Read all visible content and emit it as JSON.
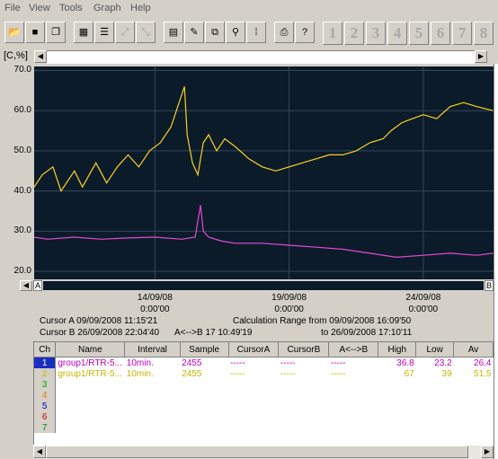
{
  "menu": [
    "File",
    "View",
    "Tools",
    "Graph",
    "Help"
  ],
  "toolbar": {
    "buttons": [
      "open-icon",
      "save-icon",
      "copy-icon",
      "channel-icon",
      "list-icon",
      "zoom-fit-icon",
      "zoom-out-icon",
      "table-icon",
      "edit-icon",
      "compare-icon",
      "link-icon",
      "cursor-icon",
      "print-icon",
      "help-icon"
    ],
    "pages": [
      {
        "label": "1",
        "active": true
      },
      {
        "label": "2",
        "active": true
      },
      {
        "label": "3",
        "active": false
      },
      {
        "label": "4",
        "active": false
      },
      {
        "label": "5",
        "active": false
      },
      {
        "label": "6",
        "active": false
      },
      {
        "label": "7",
        "active": false
      },
      {
        "label": "8",
        "active": false
      }
    ]
  },
  "unit_label": "[C,%]",
  "scrollbar": {
    "left_marker": "A",
    "right_marker": "B"
  },
  "chart_data": {
    "type": "line",
    "ylabel": "[C,%]",
    "ylim": [
      18,
      71
    ],
    "y_ticks": [
      "70.0",
      "60.0",
      "50.0",
      "40.0",
      "30.0",
      "20.0"
    ],
    "y_tick_values": [
      70,
      60,
      50,
      40,
      30,
      20
    ],
    "x_ticks": [
      {
        "date": "14/09/08",
        "time": "0:00'00",
        "x": 5
      },
      {
        "date": "19/09/08",
        "time": "0:00'00",
        "x": 10
      },
      {
        "date": "24/09/08",
        "time": "0:00'00",
        "x": 15
      }
    ],
    "xlim": [
      0.5,
      17.65
    ],
    "grid": true,
    "series": [
      {
        "name": "group1/RTR-5...",
        "color": "#f7d21e",
        "x": [
          0.5,
          0.8,
          1.2,
          1.5,
          2.0,
          2.3,
          2.8,
          3.2,
          3.6,
          4.0,
          4.4,
          4.8,
          5.2,
          5.6,
          5.9,
          6.1,
          6.2,
          6.4,
          6.6,
          6.8,
          7.0,
          7.3,
          7.6,
          8.0,
          8.5,
          9.0,
          9.5,
          10.0,
          10.5,
          11.0,
          11.5,
          12.0,
          12.5,
          13.0,
          13.5,
          13.8,
          14.2,
          14.6,
          15.0,
          15.5,
          16.0,
          16.5,
          17.0,
          17.6
        ],
        "values": [
          41,
          44,
          46,
          40,
          45,
          41,
          47,
          42,
          46,
          49,
          46,
          50,
          52,
          56,
          62,
          66,
          54,
          47,
          44,
          52,
          54,
          50,
          53,
          51,
          48,
          46,
          45,
          46,
          47,
          48,
          49,
          49,
          50,
          52,
          53,
          55,
          57,
          58,
          59,
          58,
          61,
          62,
          61,
          60
        ]
      },
      {
        "name": "group1/RTR-5...",
        "color": "#e04ad0",
        "x": [
          0.5,
          1.0,
          2.0,
          3.0,
          4.0,
          5.0,
          6.0,
          6.5,
          6.7,
          6.8,
          7.0,
          7.5,
          8.0,
          9.0,
          10.0,
          11.0,
          12.0,
          13.0,
          14.0,
          15.0,
          16.0,
          17.0,
          17.6
        ],
        "values": [
          28.5,
          28.0,
          28.5,
          28.0,
          28.3,
          28.5,
          28.0,
          28.5,
          36.5,
          30.0,
          28.5,
          27.5,
          27.0,
          27.0,
          26.5,
          26.0,
          25.5,
          24.5,
          23.5,
          24.0,
          24.5,
          24.0,
          24.5
        ]
      }
    ]
  },
  "info": {
    "cursor_a": "Cursor A 09/09/2008 11:15'21",
    "cursor_b": "Cursor B 26/09/2008 22:04'40",
    "a_to_b": "A<-->B 17 10:49'19",
    "calc_range": "Calculation Range from 09/09/2008 16:09'50",
    "calc_to": "to 26/09/2008 17:10'11"
  },
  "table": {
    "headers": [
      "Ch",
      "Name",
      "Interval",
      "Sample",
      "CursorA",
      "CursorB",
      "A<-->B",
      "High",
      "Low",
      "Av"
    ],
    "rows": [
      {
        "ch": "1",
        "color": "#c000c0",
        "name": "group1/RTR-5...",
        "interval": "10min.",
        "sample": "2455",
        "cursor_a": "-----",
        "cursor_b": "-----",
        "ab": "-----",
        "high": "36.8",
        "low": "23.2",
        "av": "26.4"
      },
      {
        "ch": "2",
        "color": "#c8b400",
        "name": "group1/RTR-5...",
        "interval": "10min.",
        "sample": "2455",
        "cursor_a": "-----",
        "cursor_b": "-----",
        "ab": "-----",
        "high": "67",
        "low": "39",
        "av": "51.5"
      },
      {
        "ch": "3",
        "color": "#00a000"
      },
      {
        "ch": "4",
        "color": "#e08000"
      },
      {
        "ch": "5",
        "color": "#0000c0"
      },
      {
        "ch": "6",
        "color": "#c00000"
      },
      {
        "ch": "7",
        "color": "#008000"
      }
    ]
  }
}
